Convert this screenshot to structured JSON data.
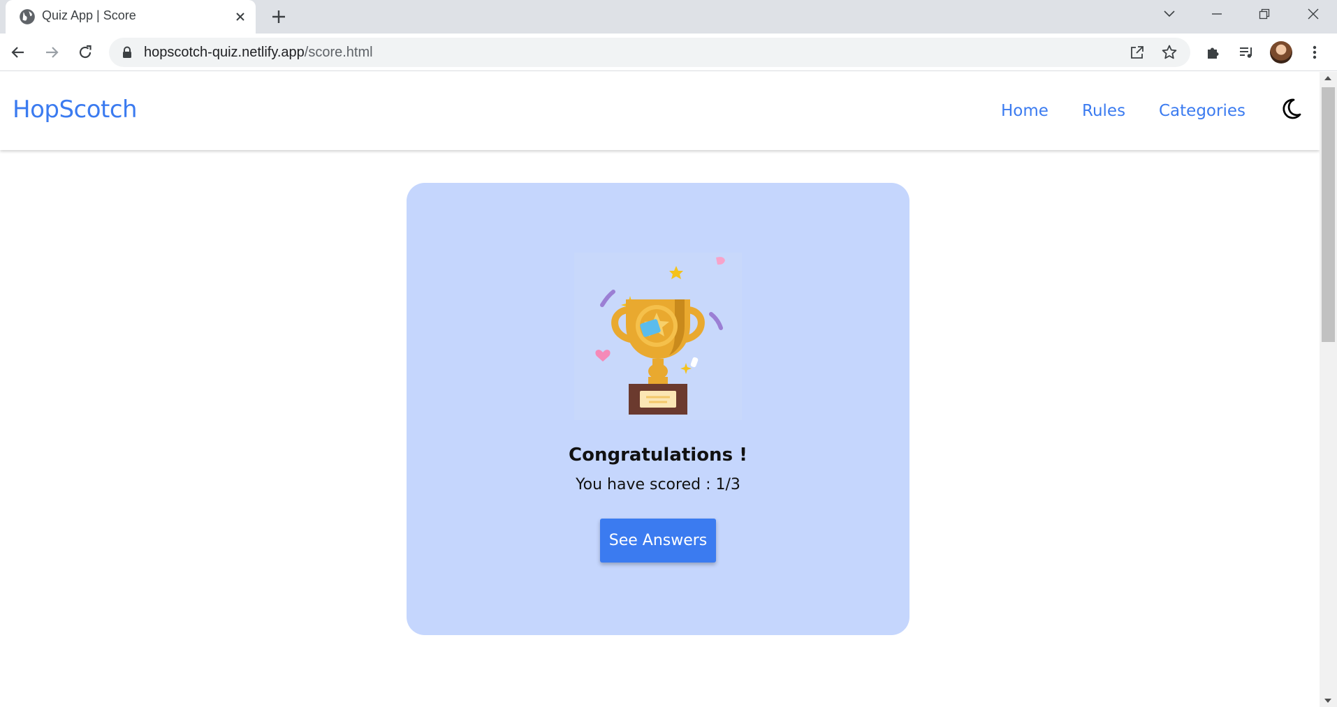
{
  "browser": {
    "tab_title": "Quiz App | Score",
    "url_host": "hopscotch-quiz.netlify.app",
    "url_path": "/score.html",
    "icons": [
      "globe-icon",
      "close-icon",
      "plus-icon",
      "chevron-down-icon",
      "minimize-icon",
      "restore-icon",
      "window-close-icon",
      "back-arrow-icon",
      "forward-arrow-icon",
      "reload-icon",
      "lock-icon",
      "share-icon",
      "star-icon",
      "puzzle-icon",
      "media-list-icon",
      "kebab-menu-icon"
    ]
  },
  "navbar": {
    "brand": "HopScotch",
    "links": [
      {
        "label": "Home"
      },
      {
        "label": "Rules"
      },
      {
        "label": "Categories"
      }
    ],
    "theme_icon": "moon-icon"
  },
  "result": {
    "heading": "Congratulations !",
    "score_text": "You have scored : 1/3",
    "button_label": "See Answers",
    "image": "trophy-illustration"
  },
  "colors": {
    "brand_blue": "#3b7bf0",
    "card_bg": "#c5d6fd",
    "trophy_gold": "#e9a92f"
  }
}
